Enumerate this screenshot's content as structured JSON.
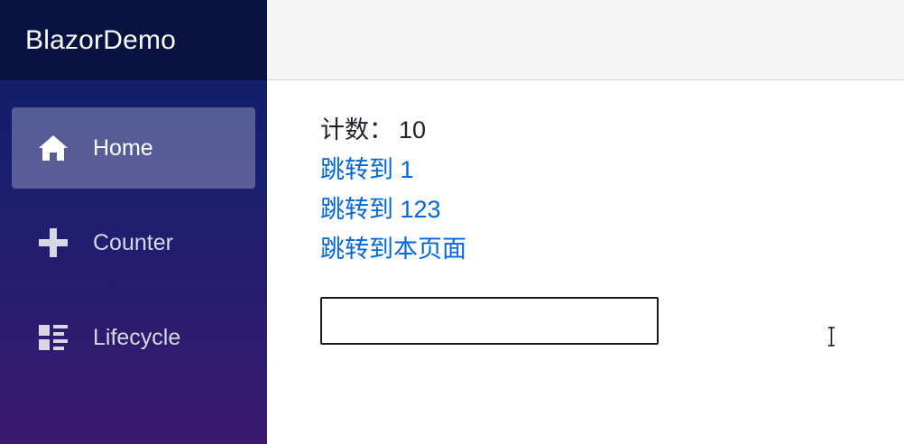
{
  "brand": {
    "title": "BlazorDemo"
  },
  "sidebar": {
    "items": [
      {
        "label": "Home",
        "icon": "home-icon",
        "active": true
      },
      {
        "label": "Counter",
        "icon": "plus-icon",
        "active": false
      },
      {
        "label": "Lifecycle",
        "icon": "list-rich-icon",
        "active": false
      }
    ]
  },
  "main": {
    "count_label": "计数：",
    "count_value": "10",
    "links": [
      {
        "label": "跳转到 1"
      },
      {
        "label": "跳转到 123"
      },
      {
        "label": "跳转到本页面"
      }
    ],
    "input": {
      "value": "",
      "placeholder": ""
    }
  },
  "colors": {
    "link": "#0366d6",
    "sidebar_top": "#0a1d66",
    "sidebar_bottom": "#3a1a6c",
    "active_item_bg": "rgba(255,255,255,0.28)"
  }
}
